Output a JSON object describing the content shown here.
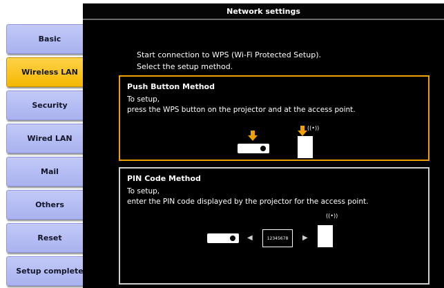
{
  "sidebar": {
    "items": [
      {
        "label": "Basic",
        "active": false
      },
      {
        "label": "Wireless LAN",
        "active": true
      },
      {
        "label": "Security",
        "active": false
      },
      {
        "label": "Wired LAN",
        "active": false
      },
      {
        "label": "Mail",
        "active": false
      },
      {
        "label": "Others",
        "active": false
      },
      {
        "label": "Reset",
        "active": false
      },
      {
        "label": "Setup complete",
        "active": false
      }
    ]
  },
  "header": {
    "title": "Network settings"
  },
  "intro": {
    "line1": "Start connection to WPS (Wi-Fi Protected Setup).",
    "line2": "Select the setup method."
  },
  "push_method": {
    "title": "Push Button Method",
    "desc1": "To setup,",
    "desc2": "press the WPS button on the projector and at the access point.",
    "wave": "((•))"
  },
  "pin_method": {
    "title": "PIN Code Method",
    "desc1": "To setup,",
    "desc2": "enter the PIN code displayed by the projector for the access point.",
    "pin_code": "12345678",
    "wave": "((•))"
  },
  "colors": {
    "active_item": "#f5b800",
    "inactive_item": "#b4bcf4",
    "selected_border": "#f0a000",
    "background": "#000000"
  }
}
